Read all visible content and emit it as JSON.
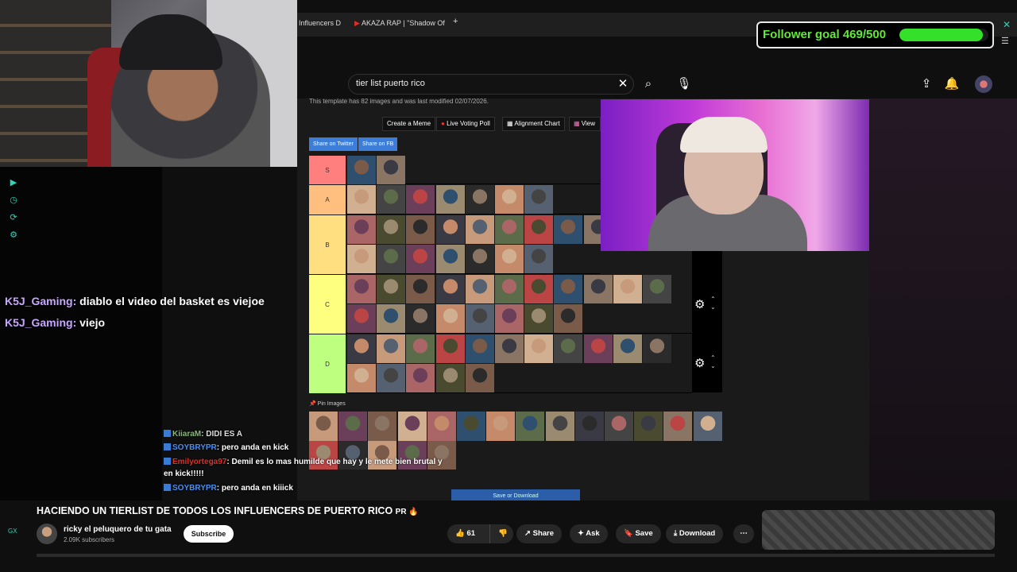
{
  "browser": {
    "tabs": [
      {
        "label": "Influencers D"
      },
      {
        "label": "AKAZA RAP | \"Shadow Of"
      }
    ],
    "new_tab_icon": "plus-icon"
  },
  "search": {
    "query": "tier list puerto rico"
  },
  "follower_goal": {
    "text": "Follower goal 469/500",
    "current": 469,
    "target": 500,
    "accent": "#5fea34"
  },
  "stream_chat": [
    {
      "user": "K5J_Gaming:",
      "message": "diablo el video del basket es viejoe"
    },
    {
      "user": "K5J_Gaming:",
      "message": "viejo"
    }
  ],
  "overlay_chat": [
    {
      "user": "KiiaraM",
      "message": ": DIDI ES A",
      "color": "green"
    },
    {
      "user": "SOYBRYPR",
      "message": ": pero anda en kick",
      "color": "blue"
    },
    {
      "user": "Emilyortega97",
      "message": ": Demil es lo mas humilde que hay y le mete bien brutal y",
      "color": "red"
    },
    {
      "user": "",
      "message": "en kick!!!!!",
      "color": "white"
    },
    {
      "user": "SOYBRYPR",
      "message": ": pero anda en kiiick",
      "color": "blue"
    }
  ],
  "tierlist": {
    "template_note": "This template has 82 images and was last modified 02/07/2026.",
    "tools": [
      "Create a Meme",
      "Live Voting Poll",
      "Alignment Chart",
      "View"
    ],
    "share": [
      "Share on Twitter",
      "Share on FB"
    ],
    "tiers": [
      {
        "label": "S",
        "color": "#ff7f7f",
        "count": 2
      },
      {
        "label": "A",
        "color": "#ffbf7f",
        "count": 7
      },
      {
        "label": "B",
        "color": "#ffdf7f",
        "count": 16
      },
      {
        "label": "C",
        "color": "#ffff7f",
        "count": 19
      },
      {
        "label": "D",
        "color": "#bfff7f",
        "count": 16
      }
    ],
    "pin_label": "Pin Images",
    "pinned_count": 19,
    "save_label": "Save or Download"
  },
  "video": {
    "title": "HACIENDO UN TIERLIST DE TODOS LOS INFLUENCERS DE PUERTO RICO",
    "title_suffix": "PR 🔥",
    "channel": "ricky el peluquero de tu gata",
    "subscribers": "2.09K subscribers",
    "subscribe_label": "Subscribe",
    "likes": "61",
    "share_label": "Share",
    "ask_label": "Ask",
    "save_label": "Save",
    "download_label": "Download"
  },
  "overlay_bottom_left": "GX"
}
